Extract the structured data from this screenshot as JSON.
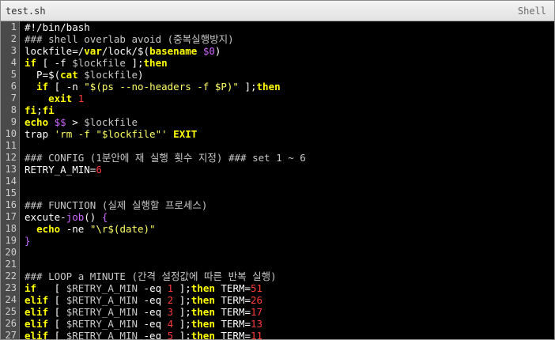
{
  "window": {
    "filename": "test.sh",
    "language": "Shell"
  },
  "colors": {
    "background": "#000000",
    "keyword": "#ffff00",
    "comment": "#c8c8c8",
    "number": "#ff3b3b",
    "operator": "#cc66ff",
    "gutter": "#4a4a4a"
  },
  "lines": [
    {
      "n": "1",
      "tokens": [
        {
          "c": "df",
          "t": "#!/bin/bash"
        }
      ]
    },
    {
      "n": "2",
      "tokens": [
        {
          "c": "cm",
          "t": "### shell overlab avoid (중복실행방지)"
        }
      ]
    },
    {
      "n": "3",
      "tokens": [
        {
          "c": "df",
          "t": "lockfile=/"
        },
        {
          "c": "kw",
          "t": "var"
        },
        {
          "c": "df",
          "t": "/lock/$("
        },
        {
          "c": "kw",
          "t": "basename"
        },
        {
          "c": "df",
          "t": " "
        },
        {
          "c": "mg",
          "t": "$0"
        },
        {
          "c": "df",
          "t": ")"
        }
      ]
    },
    {
      "n": "4",
      "tokens": [
        {
          "c": "kw",
          "t": "if"
        },
        {
          "c": "df",
          "t": " [ -f "
        },
        {
          "c": "vr",
          "t": "$lockfile"
        },
        {
          "c": "df",
          "t": " ];"
        },
        {
          "c": "kw",
          "t": "then"
        }
      ]
    },
    {
      "n": "5",
      "tokens": [
        {
          "c": "df",
          "t": "  P=$("
        },
        {
          "c": "kw",
          "t": "cat"
        },
        {
          "c": "df",
          "t": " "
        },
        {
          "c": "vr",
          "t": "$lockfile"
        },
        {
          "c": "df",
          "t": ")"
        }
      ]
    },
    {
      "n": "6",
      "tokens": [
        {
          "c": "df",
          "t": "  "
        },
        {
          "c": "kw",
          "t": "if"
        },
        {
          "c": "df",
          "t": " [ -n "
        },
        {
          "c": "st",
          "t": "\"$(ps --no-headers -f $P)\""
        },
        {
          "c": "df",
          "t": " ];"
        },
        {
          "c": "kw",
          "t": "then"
        }
      ]
    },
    {
      "n": "7",
      "tokens": [
        {
          "c": "df",
          "t": "    "
        },
        {
          "c": "kw",
          "t": "exit"
        },
        {
          "c": "df",
          "t": " "
        },
        {
          "c": "nm",
          "t": "1"
        }
      ]
    },
    {
      "n": "8",
      "tokens": [
        {
          "c": "kw",
          "t": "fi"
        },
        {
          "c": "df",
          "t": ";"
        },
        {
          "c": "kw",
          "t": "fi"
        }
      ]
    },
    {
      "n": "9",
      "tokens": [
        {
          "c": "kw",
          "t": "echo"
        },
        {
          "c": "df",
          "t": " "
        },
        {
          "c": "mg",
          "t": "$$"
        },
        {
          "c": "df",
          "t": " > "
        },
        {
          "c": "vr",
          "t": "$lockfile"
        }
      ]
    },
    {
      "n": "10",
      "tokens": [
        {
          "c": "df",
          "t": "trap "
        },
        {
          "c": "st",
          "t": "'rm -f \"$lockfile\"'"
        },
        {
          "c": "df",
          "t": " "
        },
        {
          "c": "kw",
          "t": "EXIT"
        }
      ]
    },
    {
      "n": "11",
      "tokens": []
    },
    {
      "n": "12",
      "tokens": [
        {
          "c": "cm",
          "t": "### CONFIG (1분안에 재 실행 횟수 지정) ### set 1 ~ 6"
        }
      ]
    },
    {
      "n": "13",
      "tokens": [
        {
          "c": "df",
          "t": "RETRY_A_MIN="
        },
        {
          "c": "nm",
          "t": "6"
        }
      ]
    },
    {
      "n": "14",
      "tokens": []
    },
    {
      "n": "15",
      "tokens": []
    },
    {
      "n": "16",
      "tokens": [
        {
          "c": "cm",
          "t": "### FUNCTION (실제 실행할 프로세스)"
        }
      ]
    },
    {
      "n": "17",
      "tokens": [
        {
          "c": "df",
          "t": "excute-"
        },
        {
          "c": "mg",
          "t": "job"
        },
        {
          "c": "df",
          "t": "() "
        },
        {
          "c": "mg",
          "t": "{"
        }
      ]
    },
    {
      "n": "18",
      "tokens": [
        {
          "c": "df",
          "t": "  "
        },
        {
          "c": "kw",
          "t": "echo"
        },
        {
          "c": "df",
          "t": " -ne "
        },
        {
          "c": "st",
          "t": "\"\\r$(date)\""
        }
      ]
    },
    {
      "n": "19",
      "tokens": [
        {
          "c": "mg",
          "t": "}"
        }
      ]
    },
    {
      "n": "20",
      "tokens": []
    },
    {
      "n": "21",
      "tokens": []
    },
    {
      "n": "22",
      "tokens": [
        {
          "c": "cm",
          "t": "### LOOP a MINUTE (간격 설정값에 따른 반복 실행)"
        }
      ]
    },
    {
      "n": "23",
      "tokens": [
        {
          "c": "kw",
          "t": "if"
        },
        {
          "c": "df",
          "t": "   [ "
        },
        {
          "c": "vr",
          "t": "$RETRY_A_MIN"
        },
        {
          "c": "df",
          "t": " -eq "
        },
        {
          "c": "nm",
          "t": "1"
        },
        {
          "c": "df",
          "t": " ];"
        },
        {
          "c": "kw",
          "t": "then"
        },
        {
          "c": "df",
          "t": " TERM="
        },
        {
          "c": "nm",
          "t": "51"
        }
      ]
    },
    {
      "n": "24",
      "tokens": [
        {
          "c": "kw",
          "t": "elif"
        },
        {
          "c": "df",
          "t": " [ "
        },
        {
          "c": "vr",
          "t": "$RETRY_A_MIN"
        },
        {
          "c": "df",
          "t": " -eq "
        },
        {
          "c": "nm",
          "t": "2"
        },
        {
          "c": "df",
          "t": " ];"
        },
        {
          "c": "kw",
          "t": "then"
        },
        {
          "c": "df",
          "t": " TERM="
        },
        {
          "c": "nm",
          "t": "26"
        }
      ]
    },
    {
      "n": "25",
      "tokens": [
        {
          "c": "kw",
          "t": "elif"
        },
        {
          "c": "df",
          "t": " [ "
        },
        {
          "c": "vr",
          "t": "$RETRY_A_MIN"
        },
        {
          "c": "df",
          "t": " -eq "
        },
        {
          "c": "nm",
          "t": "3"
        },
        {
          "c": "df",
          "t": " ];"
        },
        {
          "c": "kw",
          "t": "then"
        },
        {
          "c": "df",
          "t": " TERM="
        },
        {
          "c": "nm",
          "t": "17"
        }
      ]
    },
    {
      "n": "26",
      "tokens": [
        {
          "c": "kw",
          "t": "elif"
        },
        {
          "c": "df",
          "t": " [ "
        },
        {
          "c": "vr",
          "t": "$RETRY_A_MIN"
        },
        {
          "c": "df",
          "t": " -eq "
        },
        {
          "c": "nm",
          "t": "4"
        },
        {
          "c": "df",
          "t": " ];"
        },
        {
          "c": "kw",
          "t": "then"
        },
        {
          "c": "df",
          "t": " TERM="
        },
        {
          "c": "nm",
          "t": "13"
        }
      ]
    },
    {
      "n": "27",
      "tokens": [
        {
          "c": "kw",
          "t": "elif"
        },
        {
          "c": "df",
          "t": " [ "
        },
        {
          "c": "vr",
          "t": "$RETRY_A_MIN"
        },
        {
          "c": "df",
          "t": " -eq "
        },
        {
          "c": "nm",
          "t": "5"
        },
        {
          "c": "df",
          "t": " ];"
        },
        {
          "c": "kw",
          "t": "then"
        },
        {
          "c": "df",
          "t": " TERM="
        },
        {
          "c": "nm",
          "t": "11"
        }
      ]
    }
  ]
}
